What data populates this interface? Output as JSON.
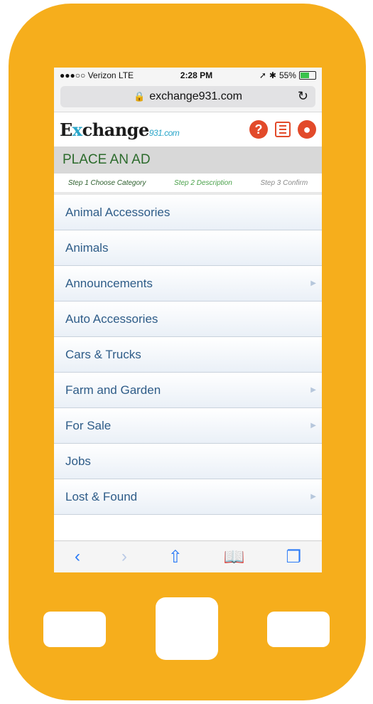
{
  "status_bar": {
    "carrier": "●●●○○ Verizon  LTE",
    "time": "2:28 PM",
    "battery": "55%"
  },
  "browser": {
    "url": "exchange931.com"
  },
  "header": {
    "logo_main": "E",
    "logo_x": "x",
    "logo_rest": "change",
    "logo_sub": "931.com"
  },
  "page": {
    "title": "PLACE AN AD",
    "steps": [
      "Step 1 Choose Category",
      "Step 2 Description",
      "Step 3 Confirm"
    ]
  },
  "categories": [
    {
      "label": "Animal Accessories",
      "arrow": ""
    },
    {
      "label": "Animals",
      "arrow": ""
    },
    {
      "label": "Announcements",
      "arrow": "▶"
    },
    {
      "label": "Auto Accessories",
      "arrow": ""
    },
    {
      "label": "Cars & Trucks",
      "arrow": ""
    },
    {
      "label": "Farm and Garden",
      "arrow": "▶"
    },
    {
      "label": "For Sale",
      "arrow": "▶"
    },
    {
      "label": "Jobs",
      "arrow": ""
    },
    {
      "label": "Lost & Found",
      "arrow": "▶"
    }
  ],
  "colors": {
    "phone": "#f6ae1c",
    "accent": "#e24a2a",
    "link": "#2e5c88"
  }
}
